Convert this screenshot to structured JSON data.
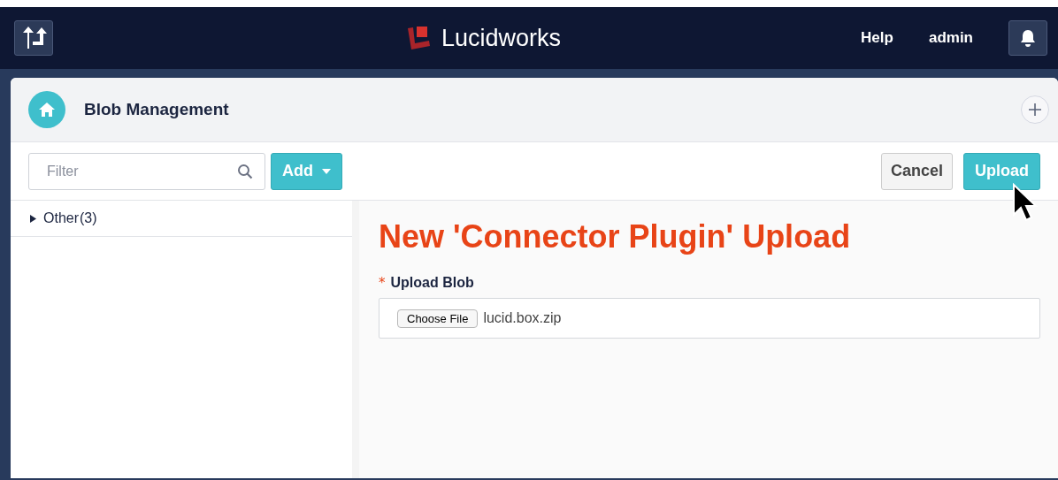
{
  "navbar": {
    "brand": "Lucidworks",
    "links": [
      "Help",
      "admin"
    ]
  },
  "page_header": {
    "title": "Blob Management"
  },
  "toolbar": {
    "filter": {
      "placeholder": "Filter"
    },
    "add_button": "Add",
    "cancel_button": "Cancel",
    "upload_button": "Upload"
  },
  "tree": [
    {
      "label": "Other",
      "count": "(3)",
      "expanded": false
    }
  ],
  "form": {
    "heading": "New 'Connector Plugin' Upload",
    "field_label": "Upload Blob",
    "required_mark": "*",
    "choose_button": "Choose File",
    "file_name": "lucid.box.zip"
  }
}
